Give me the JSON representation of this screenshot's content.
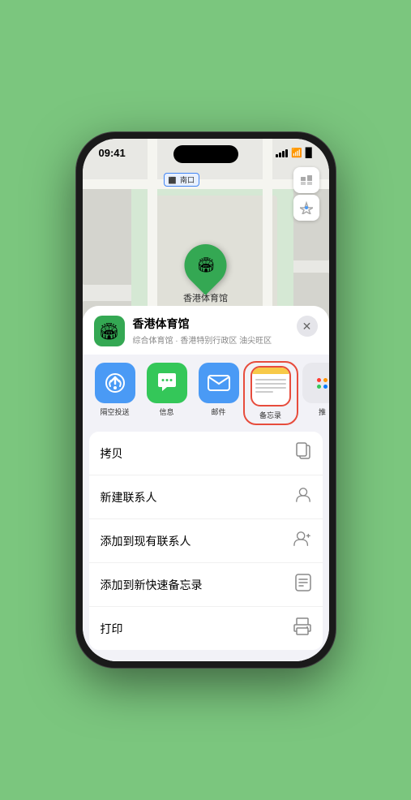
{
  "status": {
    "time": "09:41",
    "location_arrow": "▶"
  },
  "map": {
    "south_entrance_label": "南口"
  },
  "venue": {
    "name": "香港体育馆",
    "description": "综合体育馆 · 香港特别行政区 油尖旺区",
    "pin_label": "香港体育馆"
  },
  "share_items": [
    {
      "id": "airdrop",
      "label": "隔空投送",
      "type": "airdrop"
    },
    {
      "id": "message",
      "label": "信息",
      "type": "message"
    },
    {
      "id": "mail",
      "label": "邮件",
      "type": "mail"
    },
    {
      "id": "notes",
      "label": "备忘录",
      "type": "notes"
    },
    {
      "id": "more",
      "label": "推",
      "type": "more"
    }
  ],
  "actions": [
    {
      "id": "copy",
      "label": "拷贝",
      "icon": "copy"
    },
    {
      "id": "new-contact",
      "label": "新建联系人",
      "icon": "person"
    },
    {
      "id": "add-existing",
      "label": "添加到现有联系人",
      "icon": "person-add"
    },
    {
      "id": "add-note",
      "label": "添加到新快速备忘录",
      "icon": "note"
    },
    {
      "id": "print",
      "label": "打印",
      "icon": "printer"
    }
  ],
  "labels": {
    "copy": "拷贝",
    "new_contact": "新建联系人",
    "add_existing": "添加到现有联系人",
    "add_note": "添加到新快速备忘录",
    "print": "打印"
  }
}
